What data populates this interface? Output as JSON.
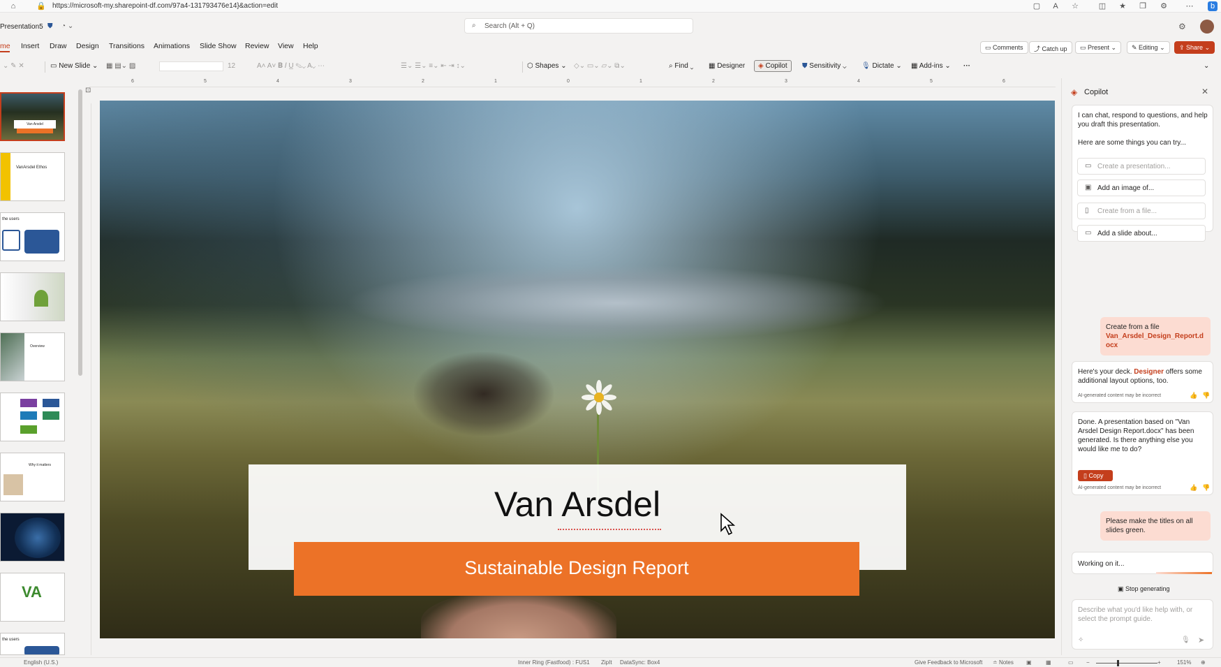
{
  "browser": {
    "url": "https://microsoft-my.sharepoint-df.com/97a4-131793476e14}&action=edit"
  },
  "titlebar": {
    "doc_name": "Presentation5",
    "search_placeholder": "Search (Alt + Q)"
  },
  "menu": {
    "tabs": [
      "me",
      "Insert",
      "Draw",
      "Design",
      "Transitions",
      "Animations",
      "Slide Show",
      "Review",
      "View",
      "Help"
    ],
    "comments": "Comments",
    "catch_up": "Catch up",
    "present": "Present",
    "editing": "Editing",
    "share": "Share"
  },
  "ribbon": {
    "new_slide": "New Slide",
    "font_size": "12",
    "shapes": "Shapes",
    "find": "Find",
    "designer": "Designer",
    "copilot": "Copilot",
    "sensitivity": "Sensitivity",
    "dictate": "Dictate",
    "addins": "Add-ins",
    "more": "···"
  },
  "ruler": [
    "6",
    "5",
    "4",
    "3",
    "2",
    "1",
    "0",
    "1",
    "2",
    "3",
    "4",
    "5",
    "6"
  ],
  "thumbnails": [
    {
      "caption": "Van Arsdel"
    },
    {
      "caption": "VanArsdel Ethos"
    },
    {
      "caption": "the users"
    },
    {
      "caption": ""
    },
    {
      "caption": "Overview"
    },
    {
      "caption": ""
    },
    {
      "caption": "Why it matters"
    },
    {
      "caption": ""
    },
    {
      "caption": ""
    },
    {
      "caption": "the users"
    }
  ],
  "slide": {
    "title": "Van Arsdel",
    "subtitle": "Sustainable Design Report"
  },
  "copilot": {
    "header": "Copilot",
    "intro": "I can chat, respond to questions, and help you draft this presentation.",
    "try_text": "Here are some things you can try...",
    "suggestions": [
      "Create a presentation...",
      "Add an image of...",
      "Create from a file...",
      "Add a slide about..."
    ],
    "user_msg1_prefix": "Create from a file",
    "user_msg1_file": "Van_Arsdel_Design_Report.docx",
    "reply1_a": "Here's your deck.",
    "reply1_designer": "Designer",
    "reply1_b": "offers some additional layout options, too.",
    "ai_note": "AI-generated content may be incorrect",
    "reply2": "Done. A presentation based on \"Van Arsdel Design Report.docx\" has been generated. Is there anything else you would like me to do?",
    "copy_label": "Copy",
    "user_msg2": "Please make the titles on all slides green.",
    "working": "Working on it...",
    "stop": "Stop generating",
    "input_placeholder": "Describe what you'd like help with, or select the prompt guide."
  },
  "status": {
    "language": "English (U.S.)",
    "ring": "Inner Ring (Fastfood) : FUS1",
    "zipit": "ZipIt",
    "datasync": "DataSync: Box4",
    "feedback": "Give Feedback to Microsoft",
    "notes": "Notes",
    "zoom": "151%"
  },
  "colors": {
    "accent": "#c43e1c",
    "subtitle_bar": "#ec7227",
    "user_bubble": "#fcdcd2"
  }
}
